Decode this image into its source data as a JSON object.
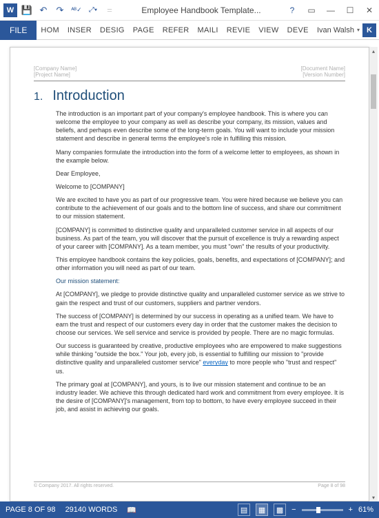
{
  "titlebar": {
    "title": "Employee Handbook Template..."
  },
  "ribbon": {
    "file": "FILE",
    "tabs": [
      "HOM",
      "INSER",
      "DESIG",
      "PAGE",
      "REFER",
      "MAILI",
      "REVIE",
      "VIEW",
      "DEVE"
    ],
    "user": "Ivan Walsh",
    "user_initial": "K"
  },
  "doc": {
    "header_left1": "[Company Name]",
    "header_left2": "[Project Name]",
    "header_right1": "[Document Name]",
    "header_right2": "[Version Number]",
    "h1_num": "1.",
    "h1_text": "Introduction",
    "p1": "The introduction is an important part of your company's employee handbook. This is where you can welcome the employee to your company as well as describe your company, its mission, values and beliefs, and perhaps even describe some of the long-term goals. You will want to include your mission statement and describe in general terms the employee's role in fulfilling this mission.",
    "p2": "Many companies formulate the introduction into the form of a welcome letter to employees, as shown in the example below.",
    "p3": "Dear Employee,",
    "p4": "Welcome to [COMPANY]",
    "p5": "We are excited to have you as part of our progressive team. You were hired because we believe you can contribute to the achievement of our goals and to the bottom line of success, and share our commitment to our mission statement.",
    "p6": "[COMPANY] is committed to distinctive quality and unparalleled customer service in all aspects of our business. As part of the team, you will discover that the pursuit of excellence is truly a rewarding aspect of your career with [COMPANY]. As a team member, you must \"own\" the results of your productivity.",
    "p7": "This employee handbook contains the key policies, goals, benefits, and expectations of [COMPANY]; and other information you will need as part of our team.",
    "sub": "Our mission statement:",
    "p8": "At [COMPANY], we pledge to provide distinctive quality and unparalleled customer service as we strive to gain the respect and trust of our customers, suppliers and partner vendors.",
    "p9": "The success of [COMPANY] is determined by our success in operating as a unified team. We have to earn the trust and respect of our customers every day in order that the customer makes the decision to choose our services. We sell service and service is provided by people. There are no magic formulas.",
    "p10a": "Our success is guaranteed by creative, productive employees who are empowered to make suggestions while thinking \"outside the box.\" Your job, every job, is essential to fulfilling our mission to \"provide distinctive quality and unparalleled customer service\" ",
    "p10_link": "everyday",
    "p10b": " to more people who \"trust and respect\" us.",
    "p11": "The primary goal at [COMPANY], and yours, is to live our mission statement and continue to be an industry leader. We achieve this through dedicated hard work and commitment from every employee. It is the desire of [COMPANY]'s management, from top to bottom, to have every employee succeed in their job, and assist in achieving our goals.",
    "footer_left": "© Company 2017. All rights reserved.",
    "footer_right": "Page 8 of 98"
  },
  "status": {
    "page": "PAGE 8 OF 98",
    "words": "29140 WORDS",
    "zoom": "61%"
  }
}
